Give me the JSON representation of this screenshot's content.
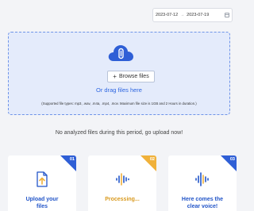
{
  "date_range": {
    "start": "2023-07-12",
    "separator": "→",
    "end": "2023-07-19"
  },
  "upload": {
    "browse_label": "Browse files",
    "drag_text": "Or drag files here",
    "supported_text": "(Supported file types: mp3, .wav, .m4a, .mp4, .mov. Maximum file size is 1GB and 2 Hours in duration.)"
  },
  "empty_message": "No analyzed files during this period, go upload now!",
  "steps": [
    {
      "number": "01",
      "title_line1": "Upload your",
      "title_line2": "files"
    },
    {
      "number": "02",
      "title_line1": "Processing...",
      "title_line2": ""
    },
    {
      "number": "03",
      "title_line1": "Here comes the",
      "title_line2": "clear voice!"
    }
  ],
  "colors": {
    "accent": "#2e66e0",
    "step_blue": "#2f5fd6",
    "step_yellow": "#f0b13a",
    "dropzone_bg": "#e4ebfb"
  },
  "icons": {
    "cloud": "cloud-attachment-icon",
    "step1": "upload-file-icon",
    "step2": "waveform-icon",
    "step3": "clear-voice-waveform-icon"
  }
}
